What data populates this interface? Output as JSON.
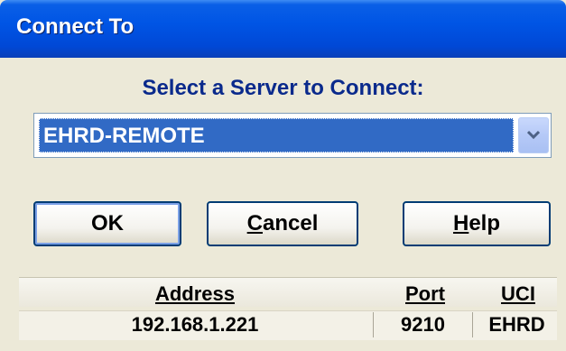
{
  "window": {
    "title": "Connect To"
  },
  "dialog": {
    "heading": "Select a Server to Connect:",
    "server_select": {
      "selected_value": "EHRD-REMOTE"
    },
    "buttons": {
      "ok": "OK",
      "cancel_mnemonic": "C",
      "cancel_rest": "ancel",
      "help_mnemonic": "H",
      "help_rest": "elp"
    },
    "table": {
      "headers": [
        "Address",
        "Port",
        "UCI"
      ],
      "rows": [
        [
          "192.168.1.221",
          "9210",
          "EHRD"
        ]
      ]
    }
  },
  "colors": {
    "title_bar": "#0055e5",
    "selection": "#316ac5",
    "heading_text": "#0a2a8c",
    "dialog_bg": "#ece9d8"
  },
  "icons": {
    "dropdown": "chevron-down-icon"
  }
}
